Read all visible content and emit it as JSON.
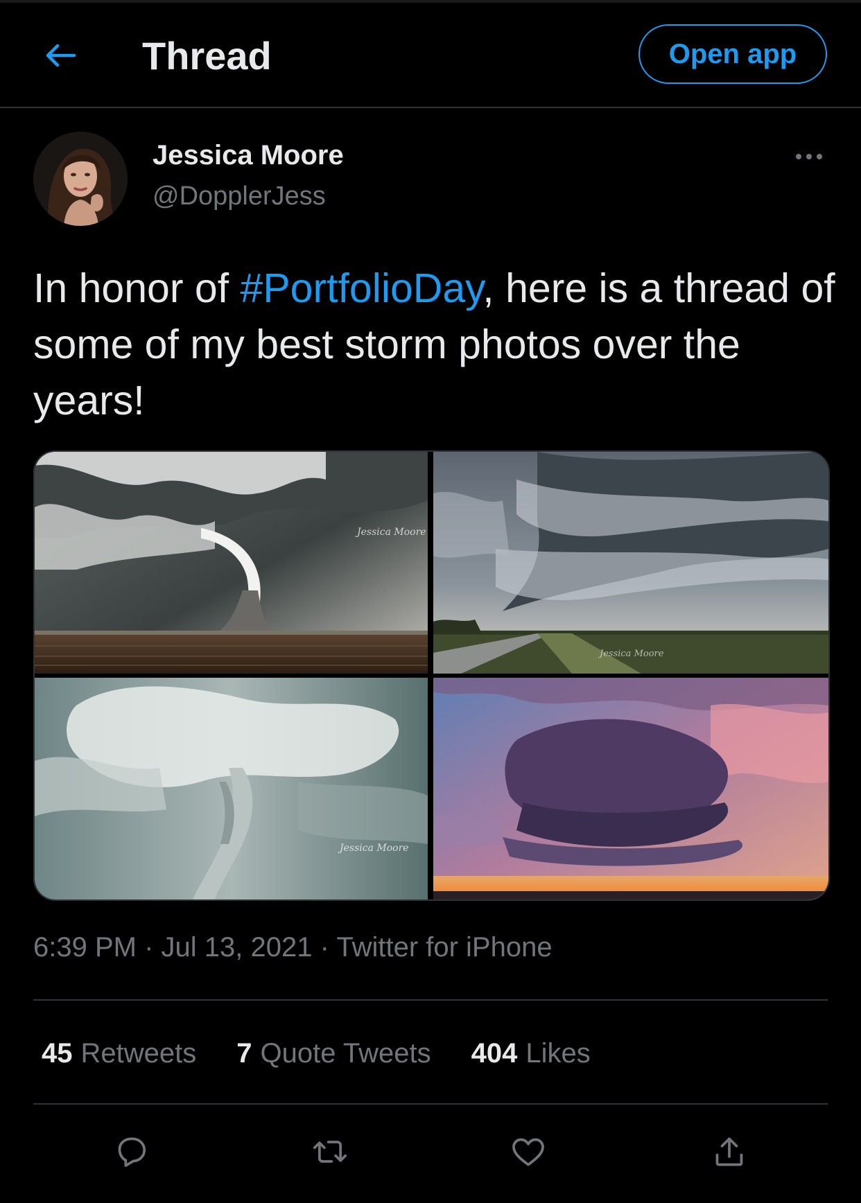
{
  "header": {
    "back_icon": "arrow-left-icon",
    "title": "Thread",
    "open_app_label": "Open app"
  },
  "tweet": {
    "author_name": "Jessica Moore",
    "author_handle": "@DopplerJess",
    "more_icon": "more-horizontal-icon",
    "text_before": "In honor of ",
    "hashtag": "#PortfolioDay",
    "text_after": ", here is a thread of some of my best storm photos over the years!",
    "photos": [
      {
        "subject": "tornado over plowed field",
        "watermark": "Jessica Moore"
      },
      {
        "subject": "supercell over highway",
        "watermark": "Jessica Moore"
      },
      {
        "subject": "tornado in clouds",
        "watermark": "Jessica Moore"
      },
      {
        "subject": "supercell at sunset",
        "watermark": ""
      }
    ],
    "time": "6:39 PM",
    "date": "Jul 13, 2021",
    "source": "Twitter for iPhone",
    "separator": "·"
  },
  "stats": {
    "retweets_count": "45",
    "retweets_label": "Retweets",
    "quotes_count": "7",
    "quotes_label": "Quote Tweets",
    "likes_count": "404",
    "likes_label": "Likes"
  },
  "actions": [
    "reply-icon",
    "retweet-icon",
    "like-icon",
    "share-icon"
  ],
  "colors": {
    "background": "#000000",
    "accent": "#1d9bf0",
    "text": "#e7e9ea",
    "muted": "#71767b",
    "divider": "#2f3336"
  }
}
